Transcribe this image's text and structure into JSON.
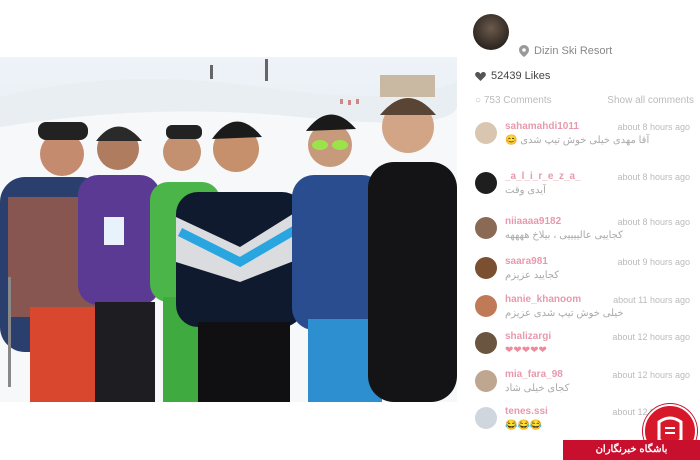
{
  "post": {
    "location": "Dizin Ski Resort",
    "likes": "52439 Likes"
  },
  "comments_header": {
    "count_label": "753 Comments",
    "show_all_label": "Show all comments"
  },
  "comments": [
    {
      "user": "sahamahdi1011",
      "time": "about 8 hours ago",
      "text": "آقا مهدی خیلی خوش تیپ شدی 😊"
    },
    {
      "user": "_a_l_i_r_e_z_a_",
      "time": "about 8 hours ago",
      "text": "آیدی وقت"
    },
    {
      "user": "niiaaaa9182",
      "time": "about 8 hours ago",
      "text": "کجاییی عالییییی ، بیلاخ ههههه"
    },
    {
      "user": "saara981",
      "time": "about 9 hours ago",
      "text": "کجایید عزیزم"
    },
    {
      "user": "hanie_khanoom",
      "time": "about 11 hours ago",
      "text": "خیلی خوش تیپ شدی عزیزم"
    },
    {
      "user": "shalizargi",
      "time": "about 12 hours ago",
      "text": "❤❤❤❤❤"
    },
    {
      "user": "mia_fara_98",
      "time": "about 12 hours ago",
      "text": "کجای خیلی شاد"
    },
    {
      "user": "tenes.ssi",
      "time": "about 12 hours ago",
      "text": "😂😂😂"
    }
  ],
  "watermark": {
    "label": "باشگاه خبرنگاران"
  },
  "colors": {
    "username": "#d4476b",
    "like_heart": "#555555",
    "watermark_red": "#c8102e"
  },
  "icons": {
    "location": "location-pin-icon",
    "likes": "heart-icon",
    "comments": "comment-bubble-icon"
  }
}
